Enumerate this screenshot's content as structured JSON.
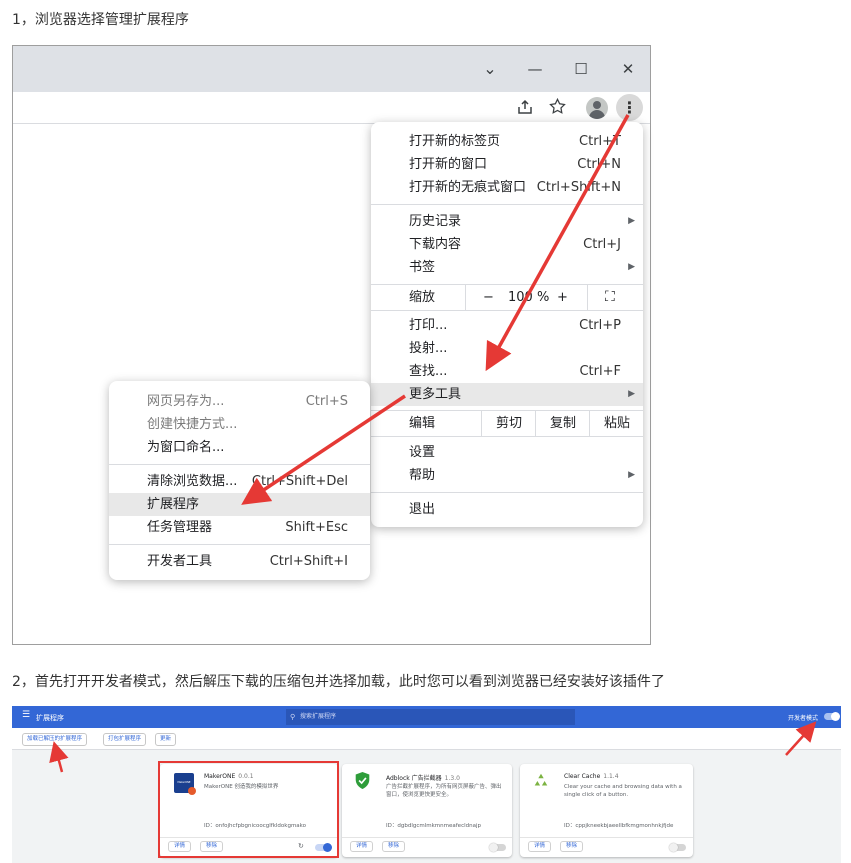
{
  "step1": {
    "text": "1，浏览器选择管理扩展程序",
    "window_controls": {
      "dropdown": "⌄",
      "minimize": "—",
      "maximize": "☐",
      "close": "✕"
    },
    "main_menu": {
      "items": [
        {
          "label": "打开新的标签页",
          "shortcut": "Ctrl+T"
        },
        {
          "label": "打开新的窗口",
          "shortcut": "Ctrl+N"
        },
        {
          "label": "打开新的无痕式窗口",
          "shortcut": "Ctrl+Shift+N"
        },
        {
          "label": "历史记录",
          "shortcut": ""
        },
        {
          "label": "下载内容",
          "shortcut": "Ctrl+J"
        },
        {
          "label": "书签",
          "shortcut": ""
        },
        {
          "label": "打印...",
          "shortcut": "Ctrl+P"
        },
        {
          "label": "投射...",
          "shortcut": ""
        },
        {
          "label": "查找...",
          "shortcut": "Ctrl+F"
        },
        {
          "label": "更多工具",
          "shortcut": ""
        },
        {
          "label": "设置",
          "shortcut": ""
        },
        {
          "label": "帮助",
          "shortcut": ""
        },
        {
          "label": "退出",
          "shortcut": ""
        }
      ],
      "zoom": {
        "label": "缩放",
        "minus": "−",
        "value": "100 %",
        "plus": "+",
        "fullscreen": "⛶"
      },
      "edit": {
        "label": "编辑",
        "cut": "剪切",
        "copy": "复制",
        "paste": "粘贴"
      }
    },
    "sub_menu": {
      "items": [
        {
          "label": "网页另存为...",
          "shortcut": "Ctrl+S"
        },
        {
          "label": "创建快捷方式...",
          "shortcut": ""
        },
        {
          "label": "为窗口命名...",
          "shortcut": ""
        },
        {
          "label": "清除浏览数据...",
          "shortcut": "Ctrl+Shift+Del"
        },
        {
          "label": "扩展程序",
          "shortcut": ""
        },
        {
          "label": "任务管理器",
          "shortcut": "Shift+Esc"
        },
        {
          "label": "开发者工具",
          "shortcut": "Ctrl+Shift+I"
        }
      ]
    }
  },
  "step2": {
    "text": "2，首先打开开发者模式，然后解压下载的压缩包并选择加载，此时您可以看到浏览器已经安装好该插件了",
    "topbar": {
      "menu_icon": "☰",
      "title": "扩展程序",
      "search_placeholder": "搜索扩展程序",
      "dev_mode": "开发者模式"
    },
    "buttons": {
      "load_unpacked": "加载已解压的扩展程序",
      "pack": "打包扩展程序",
      "update": "更新"
    },
    "cards": [
      {
        "name": "MakerONE",
        "version": "0.0.1",
        "desc": "MakerONE 创造我的模拟世界",
        "id": "ID：onfojhcfpbgnicoocglfkldokgmako",
        "details": "详情",
        "remove": "移除",
        "logo_text": "MakerONE"
      },
      {
        "name": "Adblock",
        "name_rest": " 广告拦截器",
        "version": "1.3.0",
        "desc": "广告拦截扩展程序，为所有网页屏蔽广告、弹出窗口，使浏览更快更安全。",
        "id": "ID：dgbdlgcmlmkmnmeafecldnajp",
        "details": "详情",
        "remove": "移除"
      },
      {
        "name": "Clear Cache",
        "version": "1.1.4",
        "desc": "Clear your cache and browsing data with a single click of a button.",
        "id": "ID：cppjkneekbjaeellbfkmgmonhnkjfjde",
        "details": "详情",
        "remove": "移除"
      }
    ]
  },
  "colors": {
    "accent": "#3367d6",
    "arrow_red": "#e53935",
    "highlight_box": "#e53935"
  }
}
